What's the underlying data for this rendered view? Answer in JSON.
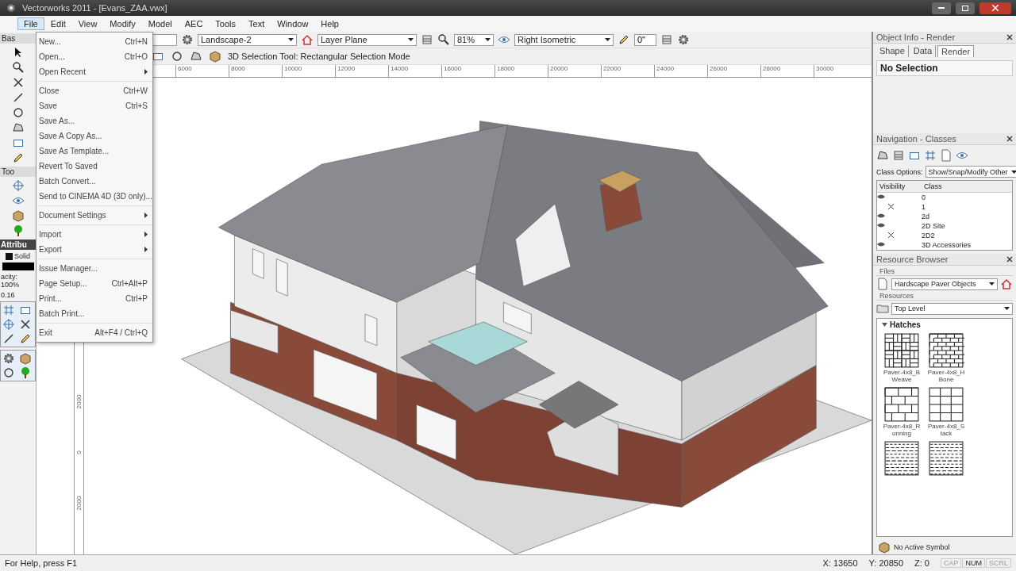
{
  "window": {
    "title": "Vectorworks 2011 - [Evans_ZAA.vwx]"
  },
  "menu_bar": [
    {
      "label": "File",
      "selected": true
    },
    {
      "label": "Edit",
      "selected": false
    },
    {
      "label": "View",
      "selected": false
    },
    {
      "label": "Modify",
      "selected": false
    },
    {
      "label": "Model",
      "selected": false
    },
    {
      "label": "AEC",
      "selected": false
    },
    {
      "label": "Tools",
      "selected": false
    },
    {
      "label": "Text",
      "selected": false
    },
    {
      "label": "Window",
      "selected": false
    },
    {
      "label": "Help",
      "selected": false
    }
  ],
  "file_menu": [
    {
      "kind": "item",
      "label": "New...",
      "shortcut": "Ctrl+N"
    },
    {
      "kind": "item",
      "label": "Open...",
      "shortcut": "Ctrl+O"
    },
    {
      "kind": "submenu",
      "label": "Open Recent"
    },
    {
      "kind": "separator"
    },
    {
      "kind": "item",
      "label": "Close",
      "shortcut": "Ctrl+W"
    },
    {
      "kind": "item",
      "label": "Save",
      "shortcut": "Ctrl+S"
    },
    {
      "kind": "item",
      "label": "Save As..."
    },
    {
      "kind": "item",
      "label": "Save A Copy As..."
    },
    {
      "kind": "item",
      "label": "Save As Template..."
    },
    {
      "kind": "item",
      "label": "Revert To Saved"
    },
    {
      "kind": "item",
      "label": "Batch Convert..."
    },
    {
      "kind": "item",
      "label": "Send to CINEMA 4D (3D only)..."
    },
    {
      "kind": "separator"
    },
    {
      "kind": "submenu",
      "label": "Document Settings"
    },
    {
      "kind": "separator"
    },
    {
      "kind": "submenu",
      "label": "Import"
    },
    {
      "kind": "submenu",
      "label": "Export"
    },
    {
      "kind": "separator"
    },
    {
      "kind": "item",
      "label": "Issue Manager..."
    },
    {
      "kind": "item",
      "label": "Page Setup...",
      "shortcut": "Ctrl+Alt+P"
    },
    {
      "kind": "item",
      "label": "Print...",
      "shortcut": "Ctrl+P"
    },
    {
      "kind": "item",
      "label": "Batch Print..."
    },
    {
      "kind": "separator"
    },
    {
      "kind": "item",
      "label": "Exit",
      "shortcut": "Alt+F4 / Ctrl+Q"
    }
  ],
  "view_bar": {
    "layer": "Landscape-2",
    "plane": "Layer Plane",
    "zoom": "81%",
    "view": "Right Isometric",
    "angle": "0\""
  },
  "mode_bar": {
    "hint": "3D Selection Tool: Rectangular Selection Mode"
  },
  "ruler": {
    "ticks": [
      "6000",
      "8000",
      "10000",
      "12000",
      "14000",
      "16000",
      "18000",
      "20000",
      "22000",
      "24000",
      "26000",
      "28000",
      "30000"
    ],
    "vertical_ticks": [
      "2000",
      "0",
      "2000"
    ]
  },
  "left_palette": {
    "basic_tab": "Bas",
    "tool_sets_tab": "Too",
    "attributes_title": "Attribu",
    "fill_style": "Solid",
    "opacity": "acity: 100%",
    "line_weight": "0.16"
  },
  "object_info": {
    "title": "Object Info - Render",
    "tabs": [
      {
        "label": "Shape",
        "selected": false
      },
      {
        "label": "Data",
        "selected": false
      },
      {
        "label": "Render",
        "selected": true
      }
    ],
    "selection": "No Selection"
  },
  "navigation": {
    "title": "Navigation - Classes",
    "class_options_label": "Class Options:",
    "class_options": "Show/Snap/Modify Other",
    "columns": [
      "Visibility",
      "Class"
    ],
    "rows": [
      {
        "name": "0",
        "visible": true
      },
      {
        "name": "1",
        "visible": false
      },
      {
        "name": "2d",
        "visible": true
      },
      {
        "name": "2D Site",
        "visible": true
      },
      {
        "name": "2D2",
        "visible": false
      },
      {
        "name": "3D Accessories",
        "visible": true
      }
    ]
  },
  "resource_browser": {
    "title": "Resource Browser",
    "files_label": "Files",
    "file": "Hardscape Paver Objects",
    "resources_label": "Resources",
    "folder": "Top Level",
    "section": "Hatches",
    "expanded": true,
    "items": [
      {
        "name": "Paver-4x8_B Weave",
        "kind": "basket"
      },
      {
        "name": "Paver-4x8_H Bone",
        "kind": "herringbone"
      },
      {
        "name": "Paver-4x8_R unning",
        "kind": "running"
      },
      {
        "name": "Paver-4x8_S tack",
        "kind": "stack"
      },
      {
        "kind": "random"
      },
      {
        "kind": "random"
      }
    ],
    "active_symbol": "No Active Symbol"
  },
  "status_bar": {
    "help": "For Help, press F1",
    "x": "X: 13650",
    "y": "Y: 20850",
    "z": "Z: 0",
    "indicators": [
      {
        "label": "CAP",
        "on": false
      },
      {
        "label": "NUM",
        "on": true
      },
      {
        "label": "SCRL",
        "on": false
      }
    ]
  }
}
